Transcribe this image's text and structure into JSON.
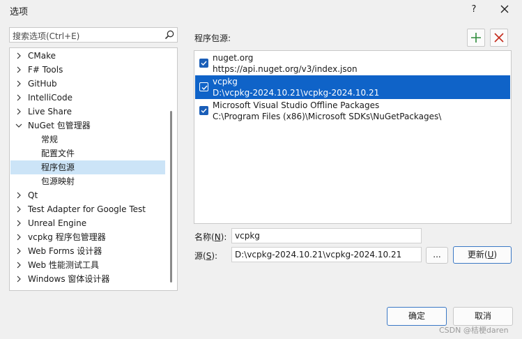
{
  "window": {
    "title": "选项",
    "help_label": "?"
  },
  "search": {
    "placeholder": "搜索选项(Ctrl+E)"
  },
  "tree": {
    "items": [
      {
        "label": "CMake",
        "expandable": true,
        "expanded": false,
        "level": 0
      },
      {
        "label": "F# Tools",
        "expandable": true,
        "expanded": false,
        "level": 0
      },
      {
        "label": "GitHub",
        "expandable": true,
        "expanded": false,
        "level": 0
      },
      {
        "label": "IntelliCode",
        "expandable": true,
        "expanded": false,
        "level": 0
      },
      {
        "label": "Live Share",
        "expandable": true,
        "expanded": false,
        "level": 0
      },
      {
        "label": "NuGet 包管理器",
        "expandable": true,
        "expanded": true,
        "level": 0
      },
      {
        "label": "常规",
        "expandable": false,
        "level": 1
      },
      {
        "label": "配置文件",
        "expandable": false,
        "level": 1
      },
      {
        "label": "程序包源",
        "expandable": false,
        "level": 1,
        "selected": true
      },
      {
        "label": "包源映射",
        "expandable": false,
        "level": 1
      },
      {
        "label": "Qt",
        "expandable": true,
        "expanded": false,
        "level": 0
      },
      {
        "label": "Test Adapter for Google Test",
        "expandable": true,
        "expanded": false,
        "level": 0
      },
      {
        "label": "Unreal Engine",
        "expandable": true,
        "expanded": false,
        "level": 0
      },
      {
        "label": "vcpkg 程序包管理器",
        "expandable": true,
        "expanded": false,
        "level": 0
      },
      {
        "label": "Web Forms 设计器",
        "expandable": true,
        "expanded": false,
        "level": 0
      },
      {
        "label": "Web 性能测试工具",
        "expandable": true,
        "expanded": false,
        "level": 0
      },
      {
        "label": "Windows 窗体设计器",
        "expandable": true,
        "expanded": false,
        "level": 0
      }
    ]
  },
  "sources": {
    "label": "程序包源:",
    "items": [
      {
        "name": "nuget.org",
        "url": "https://api.nuget.org/v3/index.json",
        "checked": true,
        "selected": false
      },
      {
        "name": "vcpkg",
        "url": "D:\\vcpkg-2024.10.21\\vcpkg-2024.10.21",
        "checked": true,
        "selected": true
      },
      {
        "name": "Microsoft Visual Studio Offline Packages",
        "url": "C:\\Program Files (x86)\\Microsoft SDKs\\NuGetPackages\\",
        "checked": true,
        "selected": false
      }
    ]
  },
  "form": {
    "name_label": "名称(",
    "name_key": "N",
    "name_suffix": "):",
    "name_value": "vcpkg",
    "source_label": "源(",
    "source_key": "S",
    "source_suffix": "):",
    "source_value": "D:\\vcpkg-2024.10.21\\vcpkg-2024.10.21",
    "browse_label": "...",
    "update_label": "更新(",
    "update_key": "U",
    "update_suffix": ")"
  },
  "footer": {
    "ok_label": "确定",
    "cancel_label": "取消",
    "watermark": "CSDN @桔梗daren"
  },
  "colors": {
    "accent": "#0f63c8",
    "tree_selected": "#cce4f7",
    "add_icon": "#2e8b3a",
    "delete_icon": "#c42b1c"
  }
}
